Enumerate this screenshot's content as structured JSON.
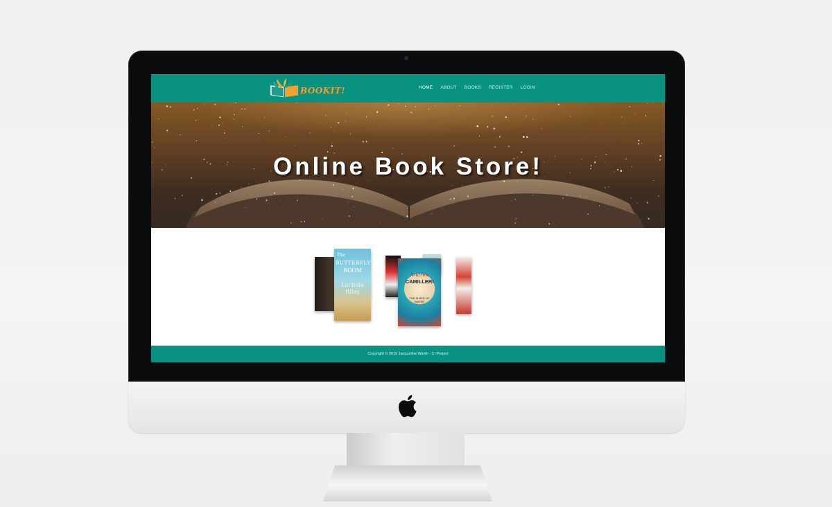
{
  "brand": {
    "name": "BOOKIT!",
    "text_color": "#f1a12f",
    "nav_bg": "#099282"
  },
  "nav": {
    "items": [
      "HOME",
      "ABOUT",
      "BOOKS",
      "REGISTER",
      "LOGIN"
    ],
    "active": "HOME"
  },
  "hero": {
    "title": "Online Book Store!"
  },
  "books": [
    {
      "title_line1": "The",
      "title_line2": "BUTTERFLY",
      "title_line3": "ROOM",
      "author": "Lucinda Riley"
    },
    {
      "author_first": "Andrea",
      "author_last": "CAMILLERI",
      "title": "THE SHAPE OF WATER"
    }
  ],
  "footer": {
    "copyright": "Copyright © 2019 Jacqueline Walsh - CI Project"
  },
  "icons": [
    "apple-icon",
    "camera-dot",
    "book-logo-icon"
  ]
}
